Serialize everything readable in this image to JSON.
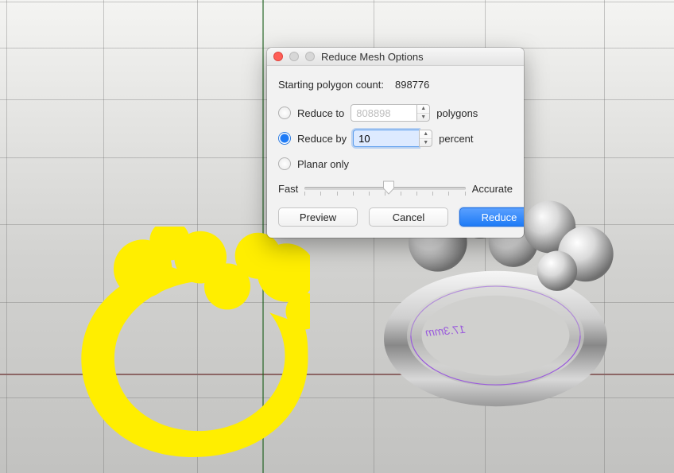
{
  "dialog": {
    "title": "Reduce Mesh Options",
    "starting_label": "Starting polygon count:",
    "starting_value": "898776",
    "reduce_to": {
      "label": "Reduce to",
      "value": "808898",
      "unit": "polygons",
      "selected": false
    },
    "reduce_by": {
      "label": "Reduce by",
      "value": "10",
      "unit": "percent",
      "selected": true
    },
    "planar_only_label": "Planar only",
    "slider": {
      "left_label": "Fast",
      "right_label": "Accurate"
    },
    "buttons": {
      "preview": "Preview",
      "cancel": "Cancel",
      "reduce": "Reduce"
    }
  },
  "viewport": {
    "dimension_text": "17.3mm"
  }
}
